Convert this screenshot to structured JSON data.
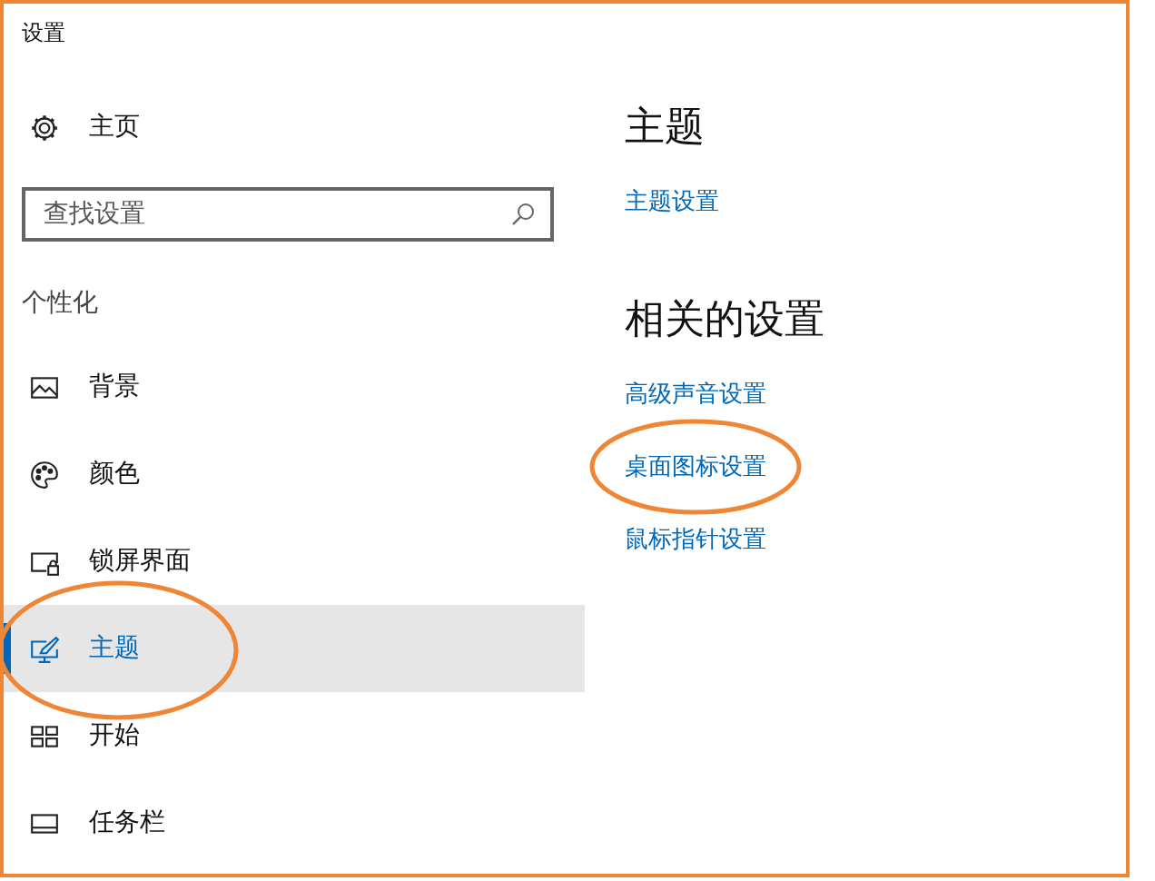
{
  "window": {
    "title": "设置"
  },
  "home": {
    "label": "主页"
  },
  "search": {
    "placeholder": "查找设置"
  },
  "section": "个性化",
  "nav_items": [
    {
      "label": "背景",
      "selected": false,
      "circled": false
    },
    {
      "label": "颜色",
      "selected": false,
      "circled": false
    },
    {
      "label": "锁屏界面",
      "selected": false,
      "circled": false
    },
    {
      "label": "主题",
      "selected": true,
      "circled": true
    },
    {
      "label": "开始",
      "selected": false,
      "circled": false
    },
    {
      "label": "任务栏",
      "selected": false,
      "circled": false
    }
  ],
  "content": {
    "heading": "主题",
    "links": [
      {
        "label": "主题设置",
        "circled": false
      }
    ],
    "related_heading": "相关的设置",
    "related_links": [
      {
        "label": "高级声音设置",
        "circled": false
      },
      {
        "label": "桌面图标设置",
        "circled": true
      },
      {
        "label": "鼠标指针设置",
        "circled": false
      }
    ]
  }
}
